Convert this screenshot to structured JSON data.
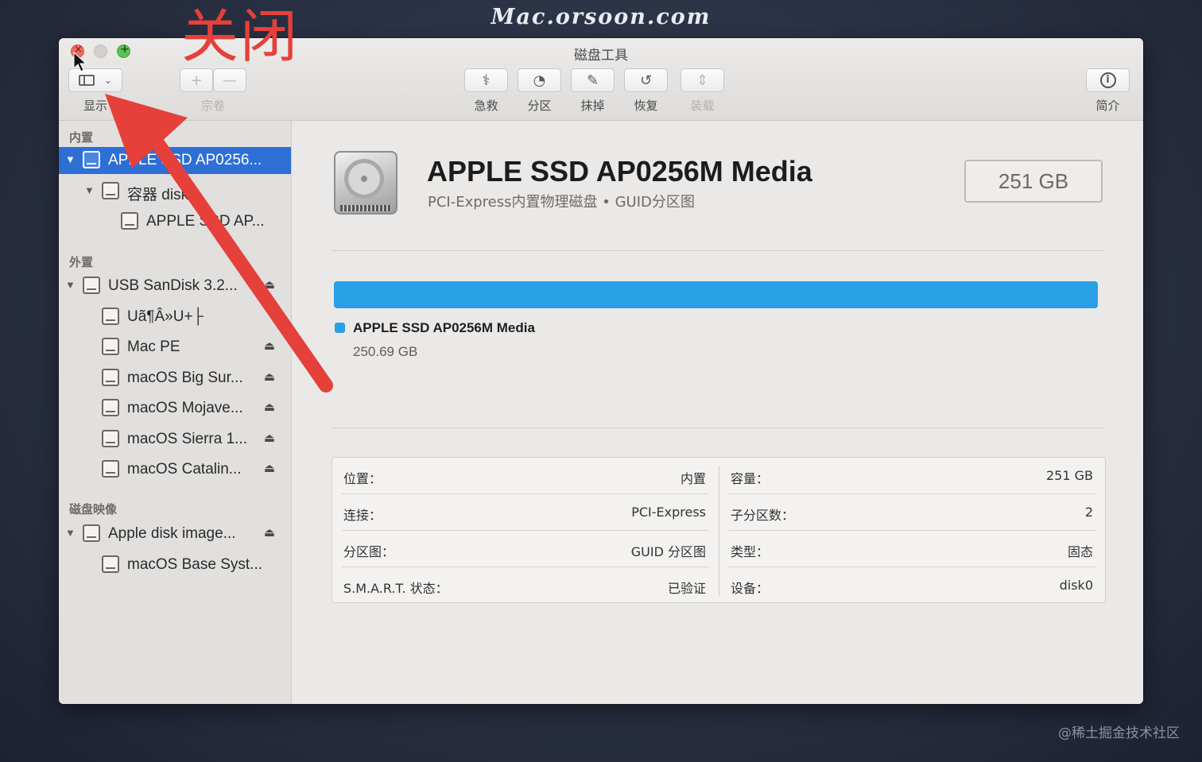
{
  "watermarks": {
    "site": "Mac.orsoon.com",
    "corner": "@稀土掘金技术社区"
  },
  "annotation": {
    "text": "关闭",
    "color": "#e5403a"
  },
  "window": {
    "title": "磁盘工具"
  },
  "toolbar": {
    "view_label": "显示",
    "volume_label": "宗卷",
    "volume_add": "+",
    "volume_remove": "—",
    "firstaid_label": "急救",
    "partition_label": "分区",
    "erase_label": "抹掉",
    "restore_label": "恢复",
    "mount_label": "装载",
    "info_label": "简介"
  },
  "sidebar": {
    "internal_header": "内置",
    "external_header": "外置",
    "images_header": "磁盘映像",
    "internal": [
      {
        "label": "APPLE SSD AP0256...",
        "selected": true,
        "level": 0,
        "expanded": true
      },
      {
        "label": "容器 disk1",
        "level": 1,
        "expanded": true
      },
      {
        "label": "APPLE SSD AP...",
        "level": 2
      }
    ],
    "external": [
      {
        "label": "USB SanDisk 3.2...",
        "level": 0,
        "eject": true,
        "expanded": true
      },
      {
        "label": "Uã¶Â»U+├",
        "level": 1,
        "eject": false
      },
      {
        "label": "Mac PE",
        "level": 1,
        "eject": true
      },
      {
        "label": "macOS Big Sur...",
        "level": 1,
        "eject": true
      },
      {
        "label": "macOS Mojave...",
        "level": 1,
        "eject": true
      },
      {
        "label": "macOS Sierra 1...",
        "level": 1,
        "eject": true
      },
      {
        "label": "macOS Catalin...",
        "level": 1,
        "eject": true
      }
    ],
    "images": [
      {
        "label": "Apple disk image...",
        "level": 0,
        "eject": true,
        "expanded": true
      },
      {
        "label": "macOS Base Syst...",
        "level": 1,
        "eject": false
      }
    ]
  },
  "disk": {
    "name": "APPLE SSD AP0256M Media",
    "subtitle": "PCI-Express内置物理磁盘 • GUID分区图",
    "size_badge": "251 GB",
    "usage_fraction": 1.0,
    "usage_color": "#2aa0e6",
    "legend_name": "APPLE SSD AP0256M Media",
    "legend_size": "250.69 GB"
  },
  "info": {
    "left": [
      {
        "key": "位置：",
        "value": "内置"
      },
      {
        "key": "连接：",
        "value": "PCI-Express"
      },
      {
        "key": "分区图：",
        "value": "GUID 分区图"
      },
      {
        "key": "S.M.A.R.T. 状态：",
        "value": "已验证"
      }
    ],
    "right": [
      {
        "key": "容量：",
        "value": "251 GB"
      },
      {
        "key": "子分区数：",
        "value": "2"
      },
      {
        "key": "类型：",
        "value": "固态"
      },
      {
        "key": "设备：",
        "value": "disk0"
      }
    ]
  }
}
